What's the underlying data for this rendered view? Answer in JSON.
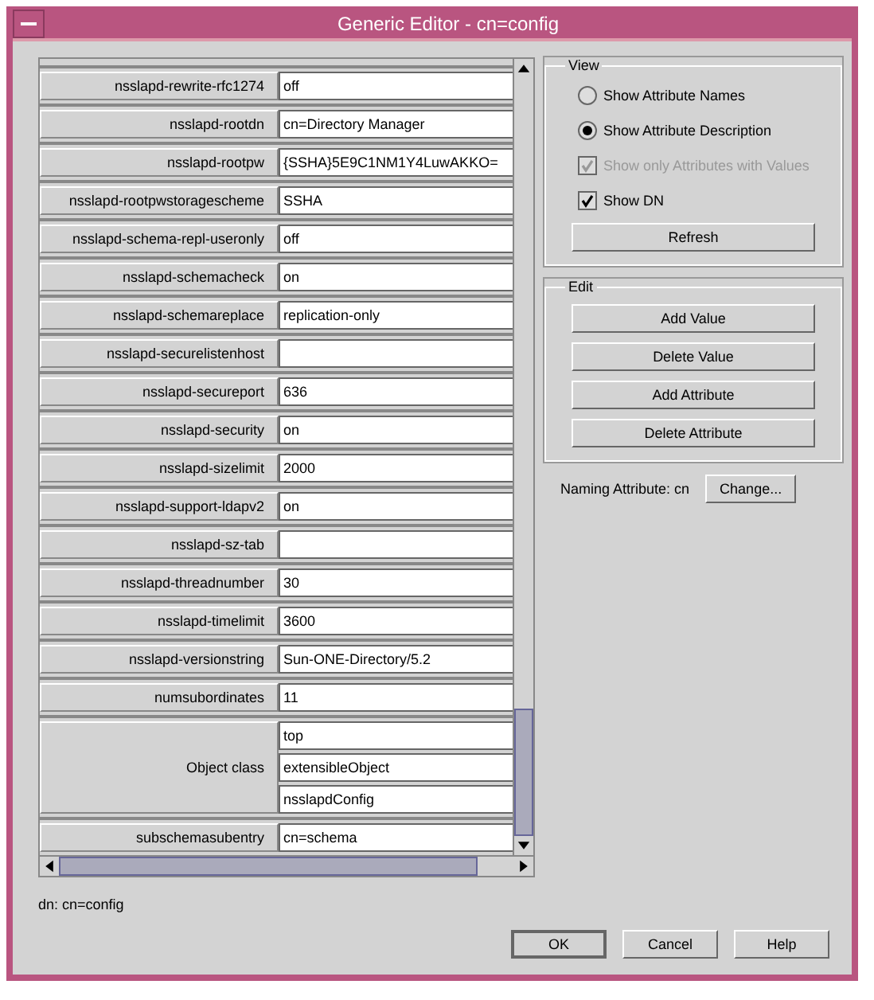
{
  "window": {
    "title": "Generic Editor - cn=config"
  },
  "attributes": [
    {
      "name": "nsslapd-rewrite-rfc1274",
      "values": [
        "off"
      ]
    },
    {
      "name": "nsslapd-rootdn",
      "values": [
        "cn=Directory Manager"
      ]
    },
    {
      "name": "nsslapd-rootpw",
      "values": [
        "{SSHA}5E9C1NM1Y4LuwAKKO="
      ]
    },
    {
      "name": "nsslapd-rootpwstoragescheme",
      "values": [
        "SSHA"
      ]
    },
    {
      "name": "nsslapd-schema-repl-useronly",
      "values": [
        "off"
      ]
    },
    {
      "name": "nsslapd-schemacheck",
      "values": [
        "on"
      ]
    },
    {
      "name": "nsslapd-schemareplace",
      "values": [
        "replication-only"
      ]
    },
    {
      "name": "nsslapd-securelistenhost"
    },
    {
      "name": "nsslapd-secureport",
      "values": [
        "636"
      ]
    },
    {
      "name": "nsslapd-security",
      "values": [
        "on"
      ]
    },
    {
      "name": "nsslapd-sizelimit",
      "values": [
        "2000"
      ]
    },
    {
      "name": "nsslapd-support-ldapv2",
      "values": [
        "on"
      ]
    },
    {
      "name": "nsslapd-sz-tab"
    },
    {
      "name": "nsslapd-threadnumber",
      "values": [
        "30"
      ]
    },
    {
      "name": "nsslapd-timelimit",
      "values": [
        "3600"
      ]
    },
    {
      "name": "nsslapd-versionstring",
      "values": [
        "Sun-ONE-Directory/5.2"
      ]
    },
    {
      "name": "numsubordinates",
      "values": [
        "11"
      ]
    },
    {
      "name": "Object class",
      "values": [
        "top",
        "extensibleObject",
        "nsslapdConfig"
      ]
    },
    {
      "name": "subschemasubentry",
      "values": [
        "cn=schema"
      ]
    }
  ],
  "dn": "dn: cn=config",
  "view": {
    "title": "View",
    "options": [
      {
        "kind": "radio",
        "label": "Show Attribute Names",
        "selected": false,
        "disabled": false
      },
      {
        "kind": "radio",
        "label": "Show Attribute Description",
        "selected": true,
        "disabled": false
      },
      {
        "kind": "checkbox",
        "label": "Show only Attributes with Values",
        "checked": true,
        "disabled": true
      },
      {
        "kind": "checkbox",
        "label": "Show DN",
        "checked": true,
        "disabled": false
      }
    ],
    "button": "Refresh"
  },
  "edit": {
    "title": "Edit",
    "buttons": [
      "Add Value",
      "Delete Value",
      "Add Attribute",
      "Delete Attribute"
    ]
  },
  "naming": {
    "label": "Naming Attribute: cn",
    "button": "Change..."
  },
  "buttons": [
    "OK",
    "Cancel",
    "Help"
  ]
}
